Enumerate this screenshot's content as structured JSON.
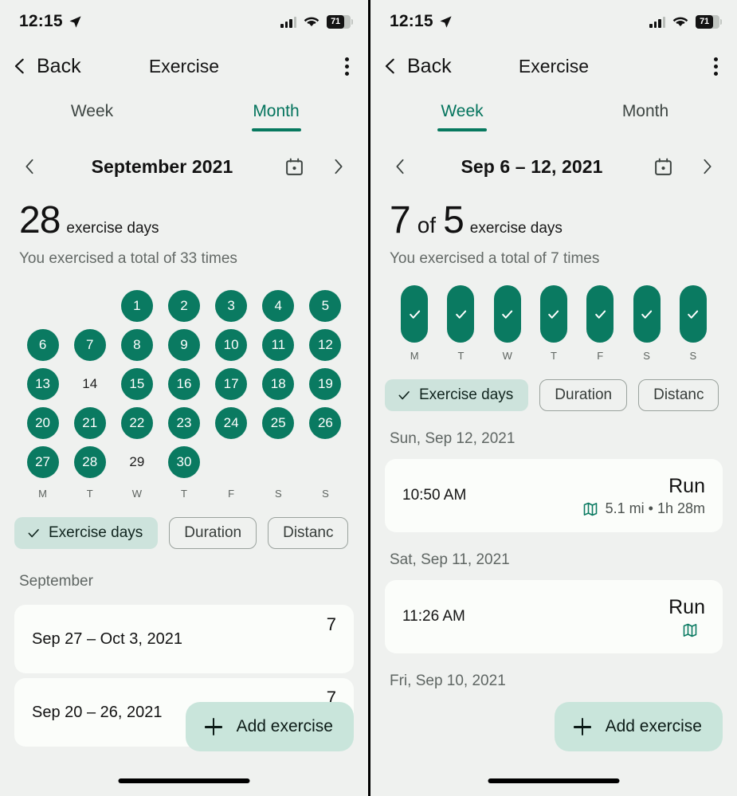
{
  "theme": {
    "accent": "#0a7a61",
    "accent_text": "#04745d",
    "chip_selected_bg": "#cde3dc",
    "fab_bg": "#c9e5db",
    "page_bg": "#eff1ef",
    "card_bg": "#fbfdfa"
  },
  "status_bar": {
    "time": "12:15",
    "location_icon": "location-arrow-icon",
    "signal_icon": "cellular-signal-icon",
    "wifi_icon": "wifi-icon",
    "battery_icon": "battery-icon",
    "battery_level": "71"
  },
  "app_bar": {
    "back_icon": "chevron-left-icon",
    "back_label": "Back",
    "title": "Exercise",
    "overflow_icon": "more-vertical-icon"
  },
  "month_screen": {
    "tabs": [
      {
        "label": "Week",
        "active": false
      },
      {
        "label": "Month",
        "active": true
      }
    ],
    "period_nav": {
      "prev_icon": "chevron-left-icon",
      "title": "September 2021",
      "calendar_icon": "calendar-icon",
      "next_icon": "chevron-right-icon"
    },
    "summary": {
      "value": "28",
      "unit": "exercise days",
      "subtitle": "You exercised a total of 33 times"
    },
    "calendar": {
      "leading_blanks": 2,
      "day_initials": [
        "M",
        "T",
        "W",
        "T",
        "F",
        "S",
        "S"
      ],
      "days": [
        {
          "n": "1",
          "done": true
        },
        {
          "n": "2",
          "done": true
        },
        {
          "n": "3",
          "done": true
        },
        {
          "n": "4",
          "done": true
        },
        {
          "n": "5",
          "done": true
        },
        {
          "n": "6",
          "done": true
        },
        {
          "n": "7",
          "done": true
        },
        {
          "n": "8",
          "done": true
        },
        {
          "n": "9",
          "done": true
        },
        {
          "n": "10",
          "done": true
        },
        {
          "n": "11",
          "done": true
        },
        {
          "n": "12",
          "done": true
        },
        {
          "n": "13",
          "done": true
        },
        {
          "n": "14",
          "done": false
        },
        {
          "n": "15",
          "done": true
        },
        {
          "n": "16",
          "done": true
        },
        {
          "n": "17",
          "done": true
        },
        {
          "n": "18",
          "done": true
        },
        {
          "n": "19",
          "done": true
        },
        {
          "n": "20",
          "done": true
        },
        {
          "n": "21",
          "done": true
        },
        {
          "n": "22",
          "done": true
        },
        {
          "n": "23",
          "done": true
        },
        {
          "n": "24",
          "done": true
        },
        {
          "n": "25",
          "done": true
        },
        {
          "n": "26",
          "done": true
        },
        {
          "n": "27",
          "done": true
        },
        {
          "n": "28",
          "done": true
        },
        {
          "n": "29",
          "done": false
        },
        {
          "n": "30",
          "done": true
        }
      ]
    },
    "chips": [
      {
        "label": "Exercise days",
        "selected": true,
        "check_icon": "check-icon"
      },
      {
        "label": "Duration",
        "selected": false
      },
      {
        "label": "Distanc",
        "selected": false
      }
    ],
    "section_label": "September",
    "rows": [
      {
        "range": "Sep 27 – Oct 3, 2021",
        "count": "7"
      },
      {
        "range": "Sep 20 – 26, 2021",
        "count": "7"
      }
    ],
    "fab": {
      "icon": "plus-icon",
      "label": "Add exercise"
    }
  },
  "week_screen": {
    "tabs": [
      {
        "label": "Week",
        "active": true
      },
      {
        "label": "Month",
        "active": false
      }
    ],
    "period_nav": {
      "prev_icon": "chevron-left-icon",
      "title": "Sep 6 – 12, 2021",
      "calendar_icon": "calendar-icon",
      "next_icon": "chevron-right-icon"
    },
    "summary": {
      "value": "7",
      "of": "of",
      "goal": "5",
      "unit": "exercise days",
      "subtitle": "You exercised a total of 7 times"
    },
    "week_pills": [
      {
        "day": "M",
        "done": true,
        "icon": "check-icon"
      },
      {
        "day": "T",
        "done": true,
        "icon": "check-icon"
      },
      {
        "day": "W",
        "done": true,
        "icon": "check-icon"
      },
      {
        "day": "T",
        "done": true,
        "icon": "check-icon"
      },
      {
        "day": "F",
        "done": true,
        "icon": "check-icon"
      },
      {
        "day": "S",
        "done": true,
        "icon": "check-icon"
      },
      {
        "day": "S",
        "done": true,
        "icon": "check-icon"
      }
    ],
    "chips": [
      {
        "label": "Exercise days",
        "selected": true,
        "check_icon": "check-icon"
      },
      {
        "label": "Duration",
        "selected": false
      },
      {
        "label": "Distanc",
        "selected": false
      }
    ],
    "entries": [
      {
        "date": "Sun, Sep 12, 2021",
        "time": "10:50 AM",
        "type": "Run",
        "map_icon": "map-icon",
        "stats": "5.1 mi • 1h 28m"
      },
      {
        "date": "Sat, Sep 11, 2021",
        "time": "11:26 AM",
        "type": "Run",
        "map_icon": "map-icon",
        "stats": ""
      }
    ],
    "trailing_date": "Fri, Sep 10, 2021",
    "fab": {
      "icon": "plus-icon",
      "label": "Add exercise"
    }
  }
}
